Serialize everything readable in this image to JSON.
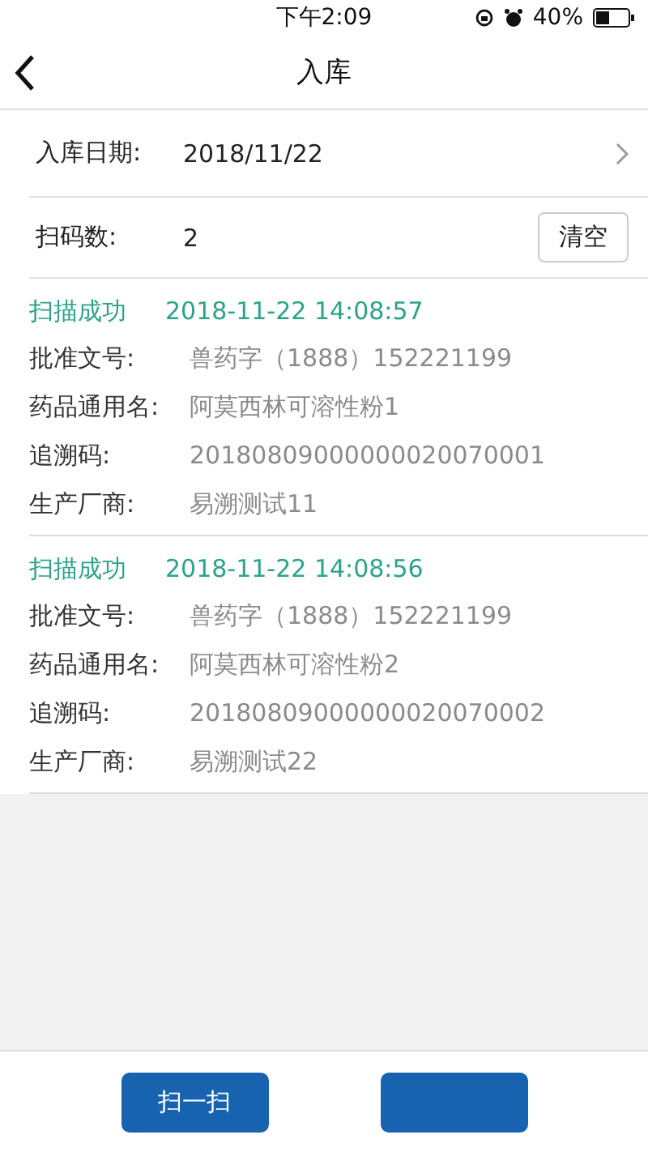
{
  "status_bar": {
    "time": "下午2:09",
    "battery": "40%"
  },
  "nav": {
    "title": "入库"
  },
  "form": [
    {
      "kind": "date",
      "label": "入库日期:",
      "value": "2018/11/22"
    },
    {
      "kind": "count",
      "label": "扫码数:",
      "value": "2",
      "action": "清空"
    }
  ],
  "records": [
    {
      "status": "扫描成功",
      "timestamp": "2018-11-22  14:08:57",
      "fields": [
        {
          "label": "批准文号:",
          "value": "兽药字（1888）152221199"
        },
        {
          "label": "药品通用名:",
          "value": "阿莫西林可溶性粉1"
        },
        {
          "label": "追溯码:",
          "value": "20180809000000020070001"
        },
        {
          "label": "生产厂商:",
          "value": "易溯测试11"
        }
      ]
    },
    {
      "status": "扫描成功",
      "timestamp": "2018-11-22  14:08:56",
      "fields": [
        {
          "label": "批准文号:",
          "value": "兽药字（1888）152221199"
        },
        {
          "label": "药品通用名:",
          "value": "阿莫西林可溶性粉2"
        },
        {
          "label": "追溯码:",
          "value": "20180809000000020070002"
        },
        {
          "label": "生产厂商:",
          "value": "易溯测试22"
        }
      ]
    }
  ],
  "footer": {
    "buttons": [
      "扫一扫"
    ]
  }
}
